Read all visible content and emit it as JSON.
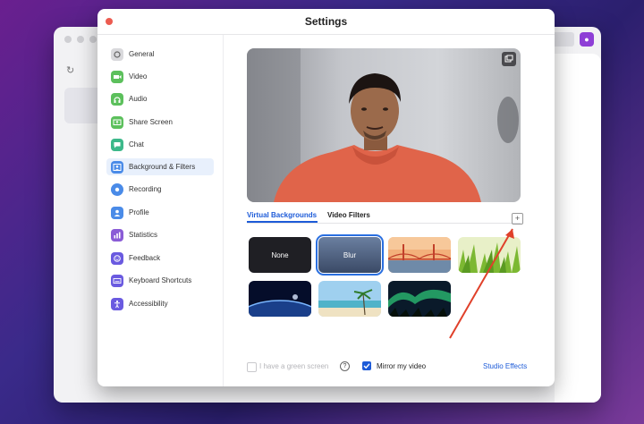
{
  "window": {
    "title": "Settings"
  },
  "background_app": {
    "avatar_icon": "app-logo-icon"
  },
  "sidebar": {
    "items": [
      {
        "label": "General",
        "icon": "gear-icon",
        "color": "#d9d9dc"
      },
      {
        "label": "Video",
        "icon": "video-icon",
        "color": "#5cc05c"
      },
      {
        "label": "Audio",
        "icon": "headphones-icon",
        "color": "#5cc05c"
      },
      {
        "label": "Share Screen",
        "icon": "share-screen-icon",
        "color": "#5cc05c"
      },
      {
        "label": "Chat",
        "icon": "chat-icon",
        "color": "#3cb88a"
      },
      {
        "label": "Background & Filters",
        "icon": "background-icon",
        "color": "#4a8be8"
      },
      {
        "label": "Recording",
        "icon": "recording-icon",
        "color": "#4a8be8"
      },
      {
        "label": "Profile",
        "icon": "profile-icon",
        "color": "#4a8be8"
      },
      {
        "label": "Statistics",
        "icon": "statistics-icon",
        "color": "#8a5cd6"
      },
      {
        "label": "Feedback",
        "icon": "feedback-icon",
        "color": "#6a5ae0"
      },
      {
        "label": "Keyboard Shortcuts",
        "icon": "keyboard-icon",
        "color": "#6a5ae0"
      },
      {
        "label": "Accessibility",
        "icon": "accessibility-icon",
        "color": "#6a5ae0"
      }
    ],
    "active": "Background & Filters"
  },
  "tabs": {
    "virtual_backgrounds": "Virtual Backgrounds",
    "video_filters": "Video Filters",
    "active": "Virtual Backgrounds"
  },
  "backgrounds": [
    {
      "label": "None",
      "kind": "none"
    },
    {
      "label": "Blur",
      "kind": "blur",
      "selected": true
    },
    {
      "label": "",
      "kind": "golden-gate"
    },
    {
      "label": "",
      "kind": "grass"
    },
    {
      "label": "",
      "kind": "earth"
    },
    {
      "label": "",
      "kind": "beach"
    },
    {
      "label": "",
      "kind": "aurora"
    }
  ],
  "options": {
    "green_screen": {
      "label": "I have a green screen",
      "checked": false
    },
    "mirror_video": {
      "label": "Mirror my video",
      "checked": true
    },
    "studio_effects": "Studio Effects"
  },
  "colors": {
    "accent": "#1d5bd8",
    "annotation_arrow": "#e0402a"
  }
}
